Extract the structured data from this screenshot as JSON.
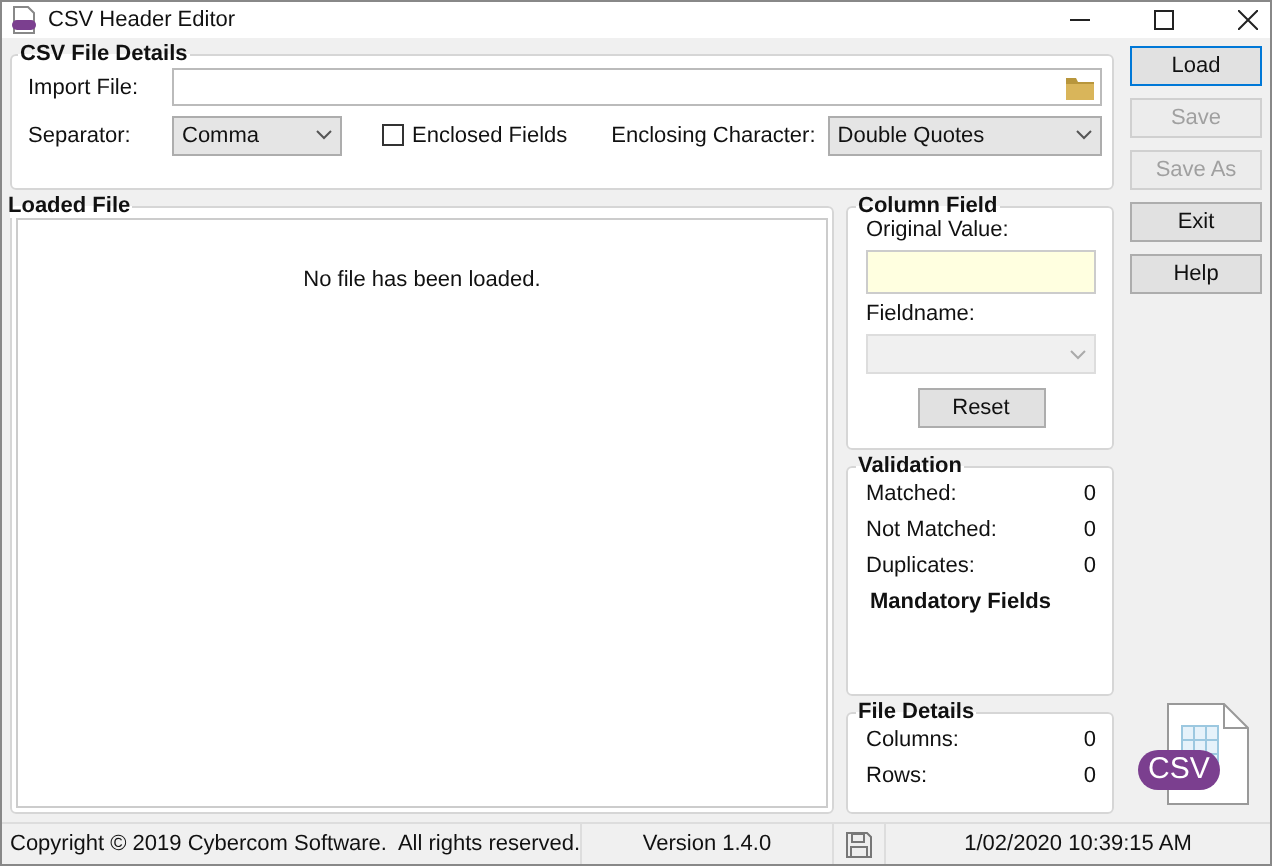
{
  "window": {
    "title": "CSV Header Editor"
  },
  "csv_file_details": {
    "title": "CSV File Details",
    "import_file_label": "Import File:",
    "separator_label": "Separator:",
    "separator_value": "Comma",
    "enclosed_fields": {
      "label": "Enclosed Fields",
      "checked": false
    },
    "enclosing_character_label": "Enclosing Character:",
    "enclosing_character_value": "Double Quotes"
  },
  "loaded_file": {
    "title": "Loaded File",
    "message": "No file has been loaded."
  },
  "column_field": {
    "title": "Column Field",
    "original_value_label": "Original Value:",
    "fieldname_label": "Fieldname:",
    "fieldname_disabled": true,
    "reset_button": "Reset"
  },
  "validation": {
    "title": "Validation",
    "rows": [
      {
        "label": "Matched:",
        "value": "0"
      },
      {
        "label": "Not Matched:",
        "value": "0"
      },
      {
        "label": "Duplicates:",
        "value": "0"
      }
    ],
    "mandatory_title": "Mandatory Fields"
  },
  "file_details": {
    "title": "File Details",
    "rows": [
      {
        "label": "Columns:",
        "value": "0"
      },
      {
        "label": "Rows:",
        "value": "0"
      }
    ]
  },
  "buttons": [
    {
      "label": "Load",
      "disabled": false,
      "default": true
    },
    {
      "label": "Save",
      "disabled": true,
      "default": false
    },
    {
      "label": "Save As",
      "disabled": true,
      "default": false
    },
    {
      "label": "Exit",
      "disabled": false,
      "default": false
    },
    {
      "label": "Help",
      "disabled": false,
      "default": false
    }
  ],
  "logo_text": "CSV",
  "status_bar": {
    "copyright": "Copyright © 2019 Cybercom Software.  All rights reserved.",
    "version": "Version 1.4.0",
    "datetime": "1/02/2020 10:39:15 AM"
  }
}
